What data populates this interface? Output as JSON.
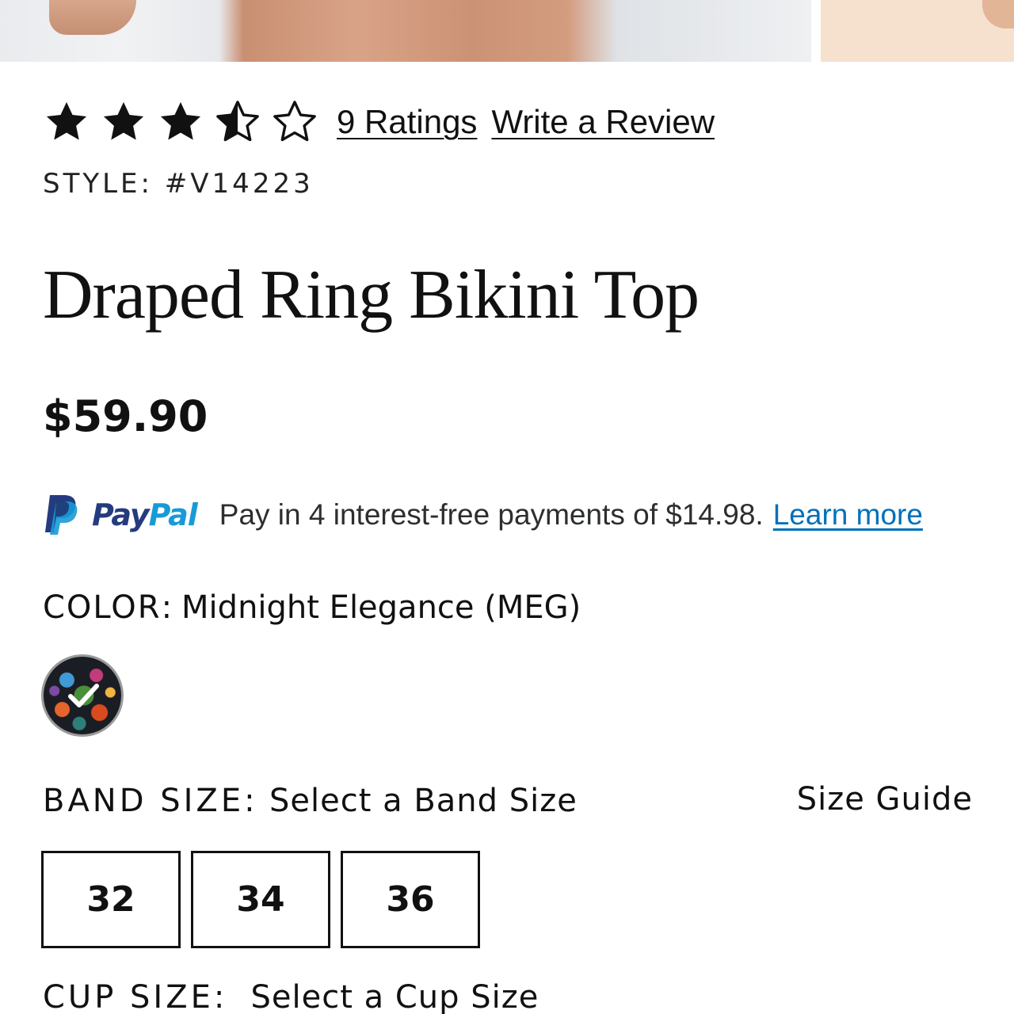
{
  "rating": {
    "stars_filled": 3.5,
    "stars_total": 5,
    "ratings_link": "9 Ratings",
    "review_link": "Write a Review"
  },
  "style": "STYLE: #V14223",
  "product": {
    "title": "Draped Ring Bikini Top",
    "price": "$59.90"
  },
  "paypal": {
    "pay": "Pay",
    "pal": "Pal",
    "message": "Pay in 4 interest-free payments of $14.98.",
    "learn_more": "Learn more",
    "colors": {
      "dark_blue": "#253b80",
      "light_blue": "#179bd7",
      "link": "#0070ba"
    }
  },
  "color": {
    "label": "COLOR",
    "colon": ":",
    "value": "Midnight Elegance (MEG)"
  },
  "band_size": {
    "label": "BAND SIZE:",
    "value": "Select a Band Size",
    "size_guide": "Size Guide",
    "options": [
      "32",
      "34",
      "36"
    ]
  },
  "cup_size": {
    "label": "CUP SIZE:",
    "value": "Select a Cup Size"
  }
}
